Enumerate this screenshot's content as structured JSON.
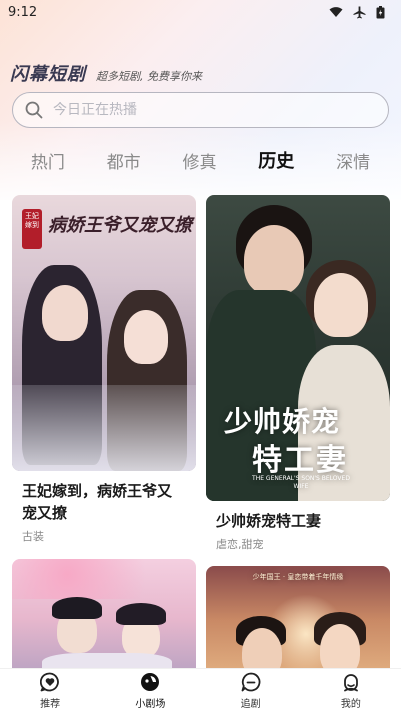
{
  "status_bar": {
    "time": "9:12"
  },
  "brand": {
    "name": "闪幕短剧",
    "slogan": "超多短剧, 免费享你来"
  },
  "search": {
    "placeholder": "今日正在热播"
  },
  "tabs": [
    {
      "label": "热门",
      "active": false
    },
    {
      "label": "都市",
      "active": false
    },
    {
      "label": "修真",
      "active": false
    },
    {
      "label": "历史",
      "active": true
    },
    {
      "label": "深情",
      "active": false
    }
  ],
  "cards": [
    {
      "title": "王妃嫁到，病娇王爷又宠又撩",
      "tags": "古装",
      "poster_text": "病娇王爷又宠又撩",
      "poster_seal": "王妃嫁到"
    },
    {
      "title": "少帅娇宠特工妻",
      "tags": "虐恋,甜宠",
      "poster_text_line1": "少帅娇宠",
      "poster_text_line2": "特工妻",
      "poster_subtext": "THE GENERAL'S SON'S BELOVED WIFE"
    },
    {
      "title": "",
      "tags": ""
    },
    {
      "title": "",
      "tags": "",
      "poster_text": "少年国王 · 皇恋带着千年情缘"
    }
  ],
  "bottom_nav": [
    {
      "label": "推荐",
      "icon": "heart-chat-icon"
    },
    {
      "label": "小剧场",
      "icon": "theater-icon",
      "active": true
    },
    {
      "label": "追剧",
      "icon": "chat-bubble-icon"
    },
    {
      "label": "我的",
      "icon": "profile-icon"
    }
  ]
}
